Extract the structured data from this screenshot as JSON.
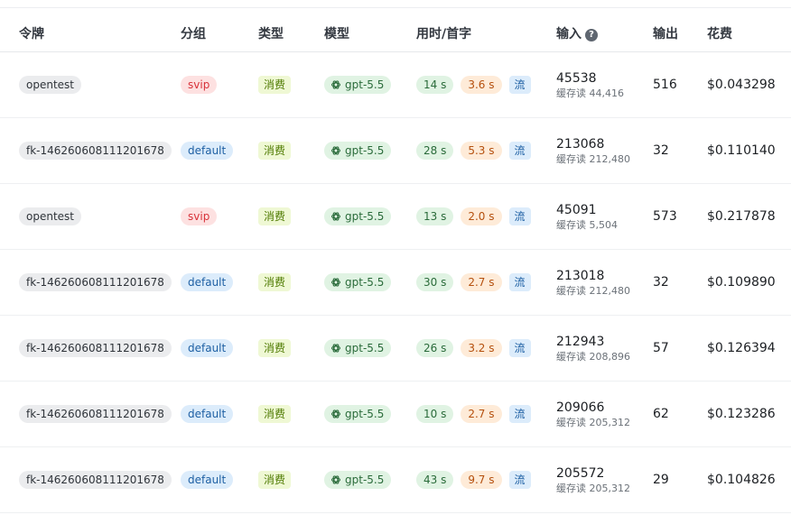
{
  "columns": {
    "token": "令牌",
    "group": "分组",
    "type": "类型",
    "model": "模型",
    "time": "用时/首字",
    "input": "输入",
    "output": "输出",
    "cost": "花费"
  },
  "icons": {
    "help": "help-circle-icon",
    "model": "openai-icon"
  },
  "colors": {
    "svip": "#fde1e1",
    "default_group": "#dcecfb",
    "type_tag": "#eff8d4",
    "model_tag": "#e0f3e3",
    "time_tag": "#e0f3e3",
    "first_token_tag": "#feebd8",
    "stream_tag": "#dcecfb"
  },
  "rows": [
    {
      "token": "opentest",
      "group": "svip",
      "type": "消费",
      "model": "gpt-5.5",
      "time": "14 s",
      "first": "3.6 s",
      "stream": "流",
      "input": "45538",
      "cache": "缓存读 44,416",
      "output": "516",
      "cost": "$0.043298"
    },
    {
      "token": "fk-146260608111201678",
      "group": "default",
      "type": "消费",
      "model": "gpt-5.5",
      "time": "28 s",
      "first": "5.3 s",
      "stream": "流",
      "input": "213068",
      "cache": "缓存读 212,480",
      "output": "32",
      "cost": "$0.110140"
    },
    {
      "token": "opentest",
      "group": "svip",
      "type": "消费",
      "model": "gpt-5.5",
      "time": "13 s",
      "first": "2.0 s",
      "stream": "流",
      "input": "45091",
      "cache": "缓存读 5,504",
      "output": "573",
      "cost": "$0.217878"
    },
    {
      "token": "fk-146260608111201678",
      "group": "default",
      "type": "消费",
      "model": "gpt-5.5",
      "time": "30 s",
      "first": "2.7 s",
      "stream": "流",
      "input": "213018",
      "cache": "缓存读 212,480",
      "output": "32",
      "cost": "$0.109890"
    },
    {
      "token": "fk-146260608111201678",
      "group": "default",
      "type": "消费",
      "model": "gpt-5.5",
      "time": "26 s",
      "first": "3.2 s",
      "stream": "流",
      "input": "212943",
      "cache": "缓存读 208,896",
      "output": "57",
      "cost": "$0.126394"
    },
    {
      "token": "fk-146260608111201678",
      "group": "default",
      "type": "消费",
      "model": "gpt-5.5",
      "time": "10 s",
      "first": "2.7 s",
      "stream": "流",
      "input": "209066",
      "cache": "缓存读 205,312",
      "output": "62",
      "cost": "$0.123286"
    },
    {
      "token": "fk-146260608111201678",
      "group": "default",
      "type": "消费",
      "model": "gpt-5.5",
      "time": "43 s",
      "first": "9.7 s",
      "stream": "流",
      "input": "205572",
      "cache": "缓存读 205,312",
      "output": "29",
      "cost": "$0.104826"
    }
  ]
}
